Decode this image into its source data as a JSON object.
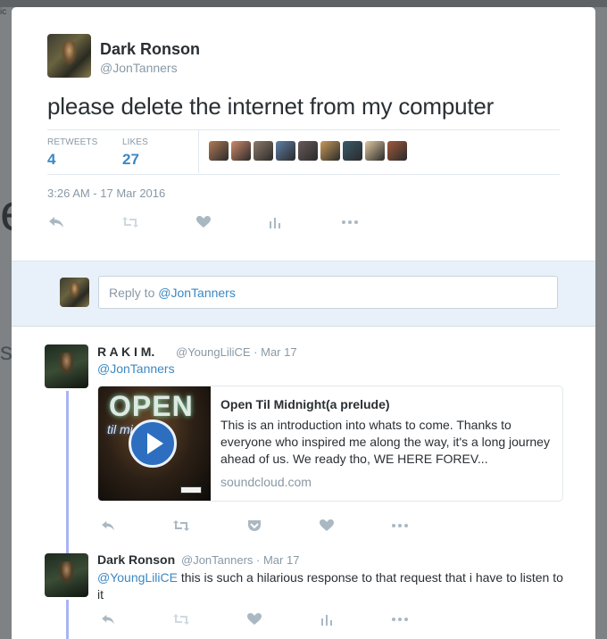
{
  "background": {
    "top_left_text": "ic",
    "ghost_letter": "e",
    "ghost_letter2": "s"
  },
  "tweet": {
    "name": "Dark Ronson",
    "handle": "@JonTanners",
    "text": "please delete the internet from my computer",
    "retweets_label": "RETWEETS",
    "retweets": "4",
    "likes_label": "LIKES",
    "likes": "27",
    "timestamp": "3:26 AM - 17 Mar 2016",
    "liker_avatar_colors": [
      "#b07a55",
      "#d08a6a",
      "#8f7a6a",
      "#5f7fa8",
      "#6a5a5a",
      "#c89a5a",
      "#3a5a6a",
      "#e0c8a0",
      "#a05a3a"
    ]
  },
  "reply_box": {
    "prefix": "Reply to ",
    "mention": "@JonTanners"
  },
  "replies": [
    {
      "name": "R A K I M.",
      "handle": "@YoungLiliCE",
      "sep": " · ",
      "date": "Mar 17",
      "mention": "@JonTanners",
      "card": {
        "image_text_open": "OPEN",
        "image_text_sub": "til mi",
        "title": "Open Til Midnight(a prelude)",
        "description": "This is an introduction into whats to come. Thanks to everyone who inspired me along the way, it's a long journey ahead of us. We ready tho, WE HERE FOREV...",
        "domain": "soundcloud.com"
      }
    },
    {
      "name": "Dark Ronson",
      "handle": "@JonTanners",
      "sep": " · ",
      "date": "Mar 17",
      "mention": "@YoungLiliCE",
      "text": " this is such a hilarious response to that request that i have to listen to it"
    }
  ],
  "colors": {
    "link": "#3b88c3",
    "muted": "#8899a6",
    "thread": "#a9b4f2",
    "reply_bg": "#e8f0fa"
  }
}
